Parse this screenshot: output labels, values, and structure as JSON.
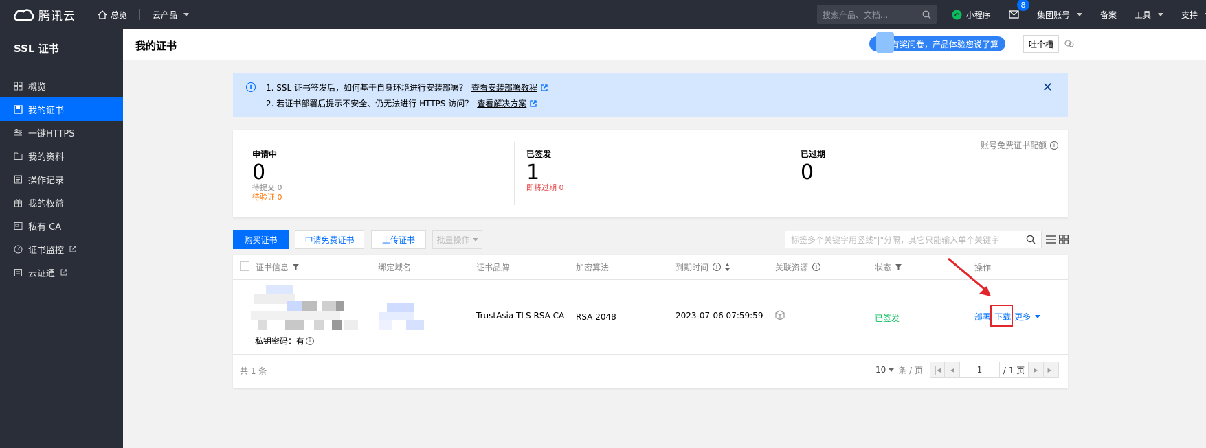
{
  "topbar": {
    "brand": "腾讯云",
    "nav_overview": "总览",
    "nav_products": "云产品",
    "search_placeholder": "搜索产品、文档...",
    "mini_program": "小程序",
    "message_count": "8",
    "group_account": "集团账号",
    "filing": "备案",
    "tools": "工具",
    "support": "支持"
  },
  "sidebar": {
    "title": "SSL 证书",
    "items": [
      {
        "label": "概览",
        "icon": "grid-icon"
      },
      {
        "label": "我的证书",
        "icon": "certificate-icon"
      },
      {
        "label": "一键HTTPS",
        "icon": "sliders-icon"
      },
      {
        "label": "我的资料",
        "icon": "folder-icon"
      },
      {
        "label": "操作记录",
        "icon": "log-icon"
      },
      {
        "label": "我的权益",
        "icon": "gift-icon"
      },
      {
        "label": "私有 CA",
        "icon": "ca-icon"
      },
      {
        "label": "证书监控",
        "icon": "monitor-icon"
      },
      {
        "label": "云证通",
        "icon": "shield-icon"
      }
    ]
  },
  "header": {
    "title": "我的证书",
    "survey": "有奖问卷，产品体验您说了算",
    "feedback": "吐个槽"
  },
  "notice": {
    "line1": "1. SSL 证书签发后，如何基于自身环境进行安装部署？",
    "link1": "查看安装部署教程",
    "line2": "2. 若证书部署后提示不安全、仍无法进行 HTTPS 访问？",
    "link2": "查看解决方案"
  },
  "stats": {
    "quota": "账号免费证书配额",
    "applying": {
      "label": "申请中",
      "value": "0",
      "sub1": "待提交 0",
      "sub2": "待验证 0"
    },
    "issued": {
      "label": "已签发",
      "value": "1",
      "sub1": "即将过期 0"
    },
    "expired": {
      "label": "已过期",
      "value": "0"
    }
  },
  "toolbar": {
    "buy": "购买证书",
    "apply_free": "申请免费证书",
    "upload": "上传证书",
    "batch": "批量操作",
    "search_placeholder": "标签多个关键字用竖线\"|\"分隔，其它只能输入单个关键字"
  },
  "table": {
    "columns": [
      "证书信息",
      "绑定域名",
      "证书品牌",
      "加密算法",
      "到期时间",
      "关联资源",
      "状态",
      "操作"
    ],
    "rows": [
      {
        "private_key": "私钥密码：有",
        "brand": "TrustAsia TLS RSA CA",
        "algorithm": "RSA 2048",
        "expire": "2023-07-06 07:59:59",
        "status": "已签发",
        "ops": {
          "deploy": "部署",
          "download": "下载",
          "more": "更多"
        }
      }
    ],
    "total": "共 1 条",
    "page_size": "10",
    "per_page": "条 / 页",
    "current_page": "1",
    "total_pages": "/ 1 页"
  },
  "colors": {
    "accent": "#006eff",
    "sidebar_bg": "#292e38",
    "success": "#0abf5b",
    "warning": "#ff7200",
    "danger": "#e54545",
    "annotation": "#e1262c"
  }
}
